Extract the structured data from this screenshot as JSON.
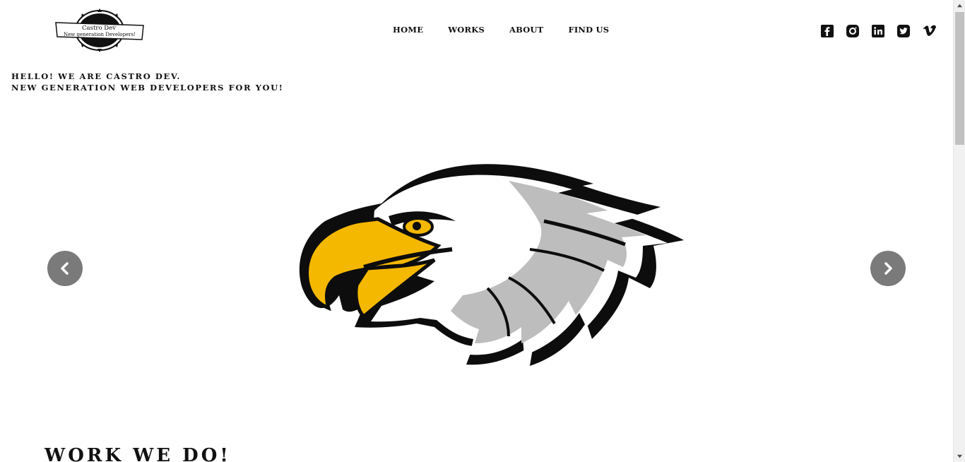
{
  "logo": {
    "line1": "Castro Dev",
    "line2": "New generation Developers!"
  },
  "nav": {
    "items": [
      {
        "label": "HOME"
      },
      {
        "label": "WORKS"
      },
      {
        "label": "ABOUT"
      },
      {
        "label": "FIND US"
      }
    ]
  },
  "social": {
    "icons": [
      "facebook-icon",
      "instagram-icon",
      "linkedin-icon",
      "twitter-icon",
      "vimeo-icon"
    ]
  },
  "hero": {
    "tagline_line1": "HELLO! WE ARE CASTRO DEV.",
    "tagline_line2": "NEW GENERATION WEB DEVELOPERS FOR YOU!"
  },
  "carousel": {
    "image": "eagle-head-logo",
    "prev_icon": "chevron-left-icon",
    "next_icon": "chevron-right-icon"
  },
  "works": {
    "title": "WORK WE DO!"
  },
  "colors": {
    "text": "#111111",
    "arrow_bg": "#7a7a7a",
    "beak": "#f5b800",
    "feather_gray": "#bdbdbd"
  }
}
